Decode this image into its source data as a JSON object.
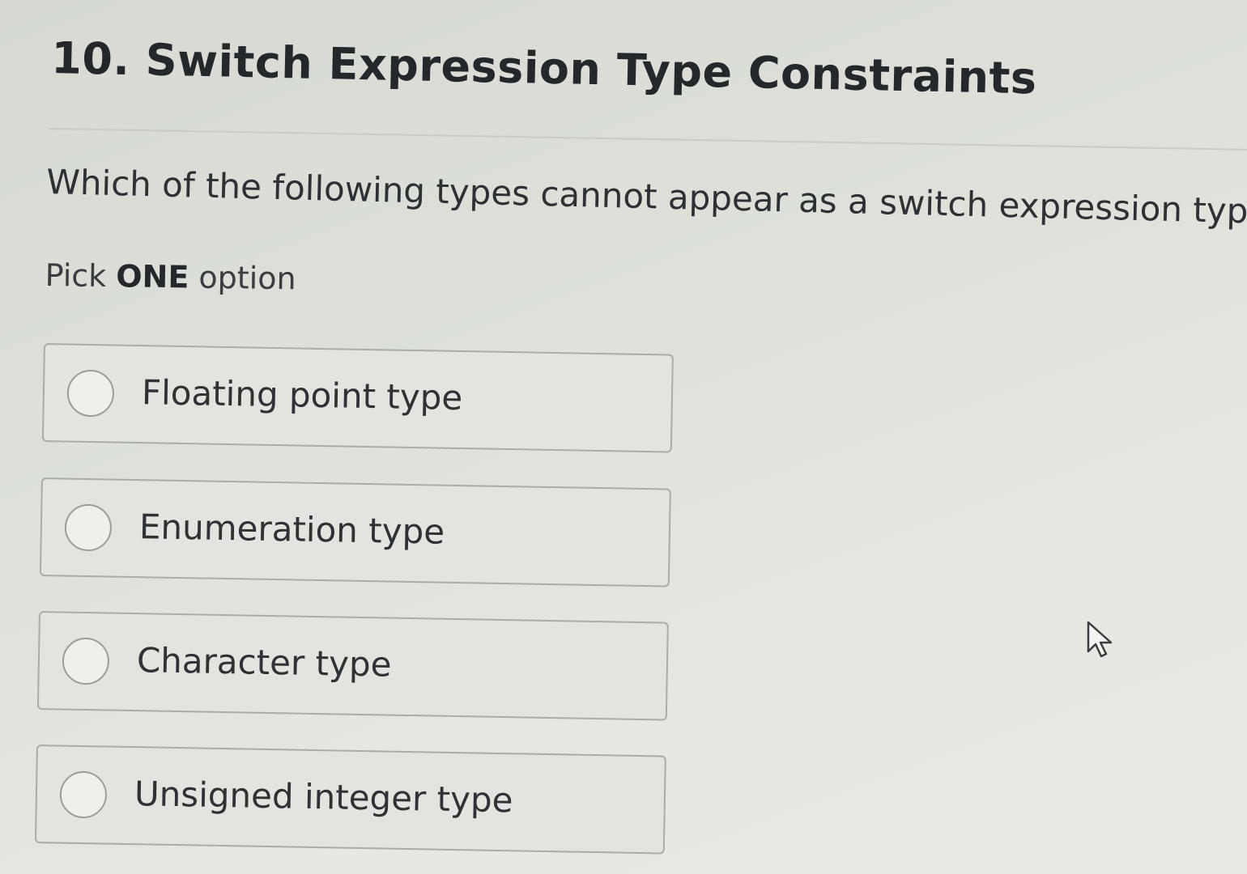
{
  "question_title": "10. Switch Expression Type Constraints",
  "question_text": "Which of the following types cannot appear as a switch expression type?",
  "instruction": {
    "prefix": "Pick ",
    "emphasis": "ONE",
    "suffix": " option"
  },
  "options": [
    {
      "label": "Floating point type",
      "selected": false
    },
    {
      "label": "Enumeration type",
      "selected": false
    },
    {
      "label": "Character type",
      "selected": false
    },
    {
      "label": "Unsigned integer type",
      "selected": false
    }
  ],
  "icons": {
    "cursor": "mouse-pointer-icon",
    "radio": "radio-button-icon"
  }
}
